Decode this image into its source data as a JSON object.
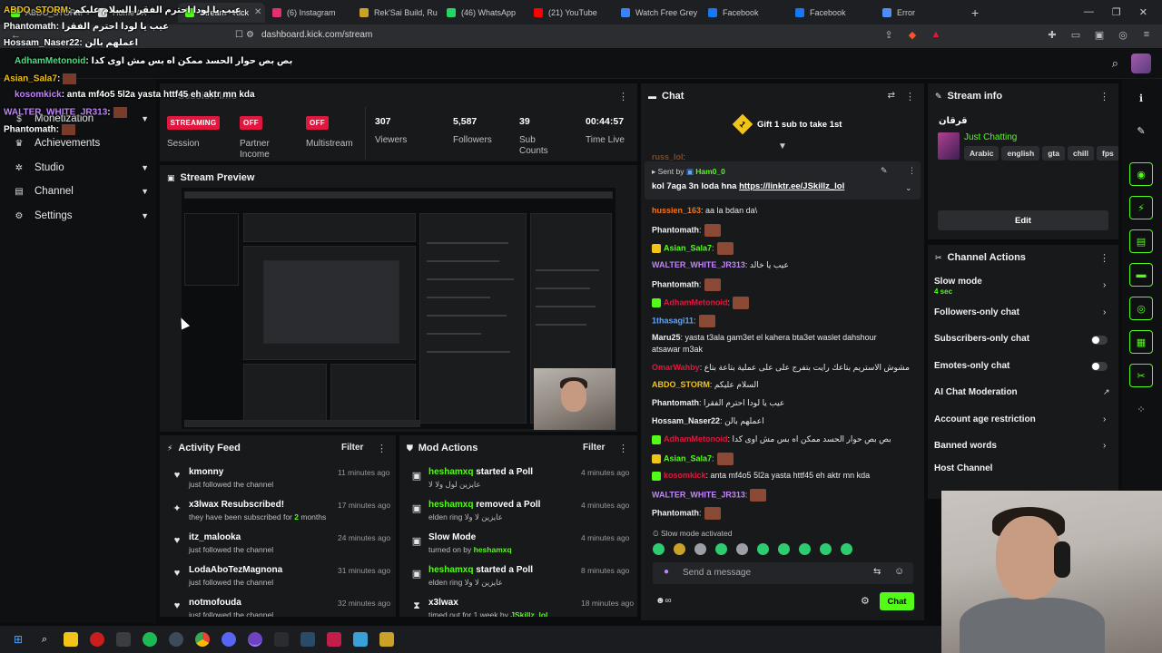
{
  "browser": {
    "tabs": [
      {
        "label": "ABDO_STORM",
        "color": "#53fc18"
      },
      {
        "label": "Home / X",
        "color": "#dddddd"
      },
      {
        "label": "Stream - Kick",
        "color": "#53fc18",
        "active": true
      },
      {
        "label": "(6) Instagram",
        "color": "#e1306c"
      },
      {
        "label": "Rek'Sai Build, Ru",
        "color": "#c9a227"
      },
      {
        "label": "(46) WhatsApp",
        "color": "#25d366"
      },
      {
        "label": "(21) YouTube",
        "color": "#ff0000"
      },
      {
        "label": "Watch Free Grey",
        "color": "#3b82f6"
      },
      {
        "label": "Facebook",
        "color": "#1877f2"
      },
      {
        "label": "Facebook",
        "color": "#1877f2"
      },
      {
        "label": "Error",
        "color": "#4f8ef7"
      }
    ],
    "url": "dashboard.kick.com/stream"
  },
  "overlay": [
    {
      "user": "ABDO_STORM",
      "text": ": عيب يا لودا احترم الفقرا السلام عليكم"
    },
    {
      "user": "Phantomath",
      "text": ": عيب يا لودا احترم الفقرا"
    },
    {
      "user": "Hossam_Naser22",
      "text": ": اعملهم بالن"
    },
    {
      "user": "AdhamMetonoid",
      "text": ": بص بص حوار الحسد ممكن اه بس مش اوى كدا"
    },
    {
      "user": "Asian_Sala7",
      "text": ":"
    },
    {
      "user": "kosomkick",
      "text": ": anta mf4o5 5l2a yasta httf45 eh aktr mn kda"
    },
    {
      "user": "WALTER_WHITE_JR313",
      "text": ":"
    },
    {
      "user": "Phantomath",
      "text": ":"
    }
  ],
  "sidebar": {
    "items": [
      {
        "label": "Monetization",
        "icon": "dollar-icon"
      },
      {
        "label": "Achievements",
        "icon": "trophy-icon"
      },
      {
        "label": "Studio",
        "icon": "studio-icon"
      },
      {
        "label": "Channel",
        "icon": "channel-icon"
      },
      {
        "label": "Settings",
        "icon": "gear-icon"
      }
    ]
  },
  "session": {
    "title": "Session info",
    "streaming": "STREAMING",
    "session_label": "Session",
    "off1": "OFF",
    "partner_label1": "Partner",
    "partner_label2": "Income",
    "off2": "OFF",
    "multistream_label": "Multistream",
    "viewers": "307",
    "viewers_label": "Viewers",
    "followers": "5,587",
    "followers_label": "Followers",
    "subs": "39",
    "subs_label1": "Sub",
    "subs_label2": "Counts",
    "time": "00:44:57",
    "time_label": "Time Live"
  },
  "preview": {
    "title": "Stream Preview"
  },
  "activity": {
    "title": "Activity Feed",
    "filter": "Filter",
    "rows": [
      {
        "title": "kmonny",
        "sub": "just followed the channel",
        "time": "11 minutes ago",
        "icon": "heart-icon"
      },
      {
        "title": "x3lwax Resubscribed!",
        "sub": "they have been subscribed for",
        "sub_count": "2",
        "sub_unit": "months",
        "time": "17 minutes ago",
        "icon": "star-icon"
      },
      {
        "title": "itz_malooka",
        "sub": "just followed the channel",
        "time": "24 minutes ago",
        "icon": "heart-icon"
      },
      {
        "title": "LodaAboTezMagnona",
        "sub": "just followed the channel",
        "time": "31 minutes ago",
        "icon": "heart-icon"
      },
      {
        "title": "notmofouda",
        "sub": "just followed the channel",
        "time": "32 minutes ago",
        "icon": "heart-icon"
      }
    ]
  },
  "mod": {
    "title": "Mod Actions",
    "filter": "Filter",
    "rows": [
      {
        "user": "heshamxq",
        "action": "started a Poll",
        "sub": "عايزين لول ولا لا",
        "time": "4 minutes ago"
      },
      {
        "user": "heshamxq",
        "action": "removed a Poll",
        "sub": "elden ring عايزين لا ولا",
        "time": "4 minutes ago"
      },
      {
        "user": "Slow Mode",
        "action": "",
        "sub": "turned on by",
        "sub_user": "heshamxq",
        "time": "4 minutes ago"
      },
      {
        "user": "heshamxq",
        "action": "started a Poll",
        "sub": "elden ring عايزين لا ولا",
        "time": "8 minutes ago"
      },
      {
        "user": "x3lwax",
        "action": "",
        "sub": "timed out for 1 week by",
        "sub_user": "JSkillz_lol",
        "time": "18 minutes ago"
      }
    ]
  },
  "chat": {
    "title": "Chat",
    "gift": "Gift 1 sub to take 1st",
    "gift_count": "1",
    "pinned_by_label": "Sent by",
    "pinned_by": "Ham0_0",
    "pinned_text": "kol 7aga 3n loda hna",
    "pinned_link": "https://linktr.ee/JSkillz_lol",
    "messages": [
      {
        "user": "russ_lol",
        "color": "#f97316",
        "text": ":"
      },
      {
        "user": "hussien_163",
        "color": "#f97316",
        "text": ": aa la bdan da\\"
      },
      {
        "user": "Phantomath",
        "color": "#f0f0f0",
        "text": ":",
        "emote": true
      },
      {
        "user": "Asian_Sala7",
        "color": "#53fc18",
        "text": ":",
        "emote": true
      },
      {
        "user": "WALTER_WHITE_JR313",
        "color": "#c084fc",
        "text": ": عيب يا خالد"
      },
      {
        "user": "Phantomath",
        "color": "#f0f0f0",
        "text": ":",
        "emote": true
      },
      {
        "user": "AdhamMetonoid",
        "color": "#e0173e",
        "text": ":",
        "emote": true
      },
      {
        "user": "1thasagi11",
        "color": "#60a5fa",
        "text": ":",
        "emote": true
      },
      {
        "user": "Maru25",
        "color": "#f0f0f0",
        "text": ": yasta t3ala gam3et el kahera bta3et waslet dahshour"
      },
      {
        "user": "",
        "color": "#f0f0f0",
        "text": "atsawar m3ak"
      },
      {
        "user": "OmarWahby",
        "color": "#e0173e",
        "text": ": مشوش الاستريم بتاعك رايت بتفرج على على عملية بتاعة بتاع"
      },
      {
        "user": "ABDO_STORM",
        "color": "#f0c419",
        "text": ": السلام عليكم"
      },
      {
        "user": "Phantomath",
        "color": "#f0f0f0",
        "text": ": عيب يا لودا احترم الفقرا"
      },
      {
        "user": "Hossam_Naser22",
        "color": "#f0f0f0",
        "text": ": اعملهم بالن"
      },
      {
        "user": "AdhamMetonoid",
        "color": "#e0173e",
        "text": ": بص بص حوار الحسد ممكن اه بس مش اوى كدا"
      },
      {
        "user": "Asian_Sala7",
        "color": "#53fc18",
        "text": ":",
        "emote": true
      },
      {
        "user": "kosomkick",
        "color": "#e0173e",
        "text": ": anta mf4o5 5l2a yasta httf45 eh aktr mn kda"
      },
      {
        "user": "WALTER_WHITE_JR313",
        "color": "#c084fc",
        "text": ":",
        "emote": true
      },
      {
        "user": "Phantomath",
        "color": "#f0f0f0",
        "text": ":",
        "emote": true
      }
    ],
    "slow_mode": "Slow mode activated",
    "placeholder": "Send a message",
    "send": "Chat"
  },
  "stream_info": {
    "title": "Stream info",
    "stream_title": "قرقان",
    "category": "Just Chatting",
    "tags": [
      "Arabic",
      "english",
      "gta",
      "chill",
      "fps"
    ],
    "edit": "Edit"
  },
  "channel_actions": {
    "title": "Channel Actions",
    "slow_mode": "Slow mode",
    "slow_val": "4 sec",
    "followers_only": "Followers-only chat",
    "subs_only": "Subscribers-only chat",
    "emotes_only": "Emotes-only chat",
    "ai_mod": "AI Chat Moderation",
    "age": "Account age restriction",
    "banned": "Banned words",
    "host": "Host Channel"
  },
  "colors": {
    "accent": "#53fc18",
    "live": "#e0173e",
    "bg": "#0b0c0d",
    "panel": "#18191b"
  }
}
